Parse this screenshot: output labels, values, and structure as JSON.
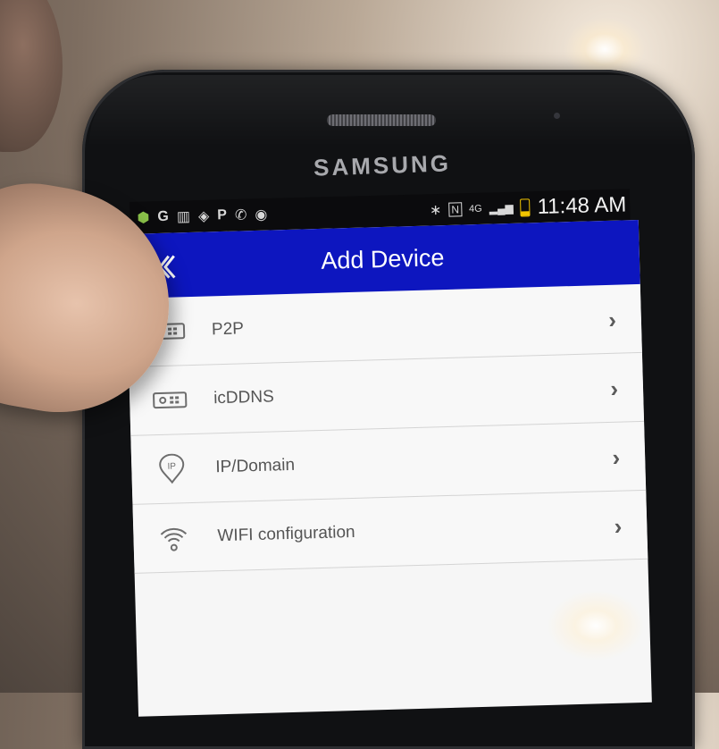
{
  "device": {
    "brand": "SAMSUNG"
  },
  "status_bar": {
    "left_icons": [
      "android-icon",
      "google-icon",
      "chart-icon",
      "tag-icon",
      "parking-icon",
      "phone-icon",
      "camera-icon"
    ],
    "left_glyphs": [
      "⬢",
      "G",
      "▥",
      "◈",
      "P",
      "✆",
      "◉"
    ],
    "right_icons": [
      "bluetooth-icon",
      "nfc-icon",
      "data-icon",
      "signal-icon",
      "battery-icon"
    ],
    "bluetooth": "∗",
    "nfc": "N",
    "data": "4G",
    "signal": "▂▄▆",
    "time": "11:48 AM"
  },
  "app_bar": {
    "title": "Add Device",
    "back_icon": "back-chevron-icon"
  },
  "menu": {
    "items": [
      {
        "label": "P2P",
        "icon": "dvr-icon"
      },
      {
        "label": "icDDNS",
        "icon": "dvr-icon"
      },
      {
        "label": "IP/Domain",
        "icon": "ip-pin-icon",
        "badge": "IP"
      },
      {
        "label": "WIFI configuration",
        "icon": "wifi-icon"
      }
    ],
    "chevron": "›"
  },
  "colors": {
    "app_bar": "#0d16bf",
    "battery": "#f2c500"
  }
}
